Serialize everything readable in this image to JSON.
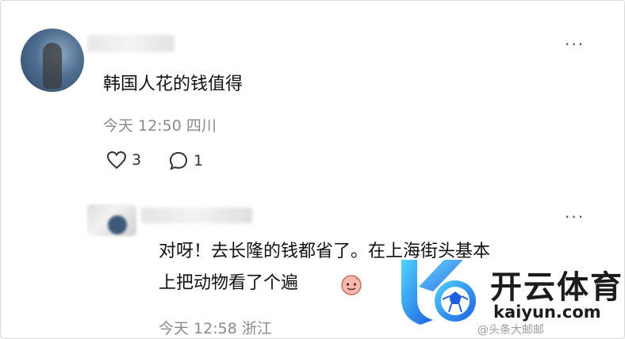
{
  "comment": {
    "text": "韩国人花的钱值得",
    "time_location": "今天 12:50 四川",
    "like_count": "3",
    "reply_count": "1",
    "more_label": "···"
  },
  "reply": {
    "line1": "对呀！去长隆的钱都省了。在上海街头基本",
    "line2": "上把动物看了个遍",
    "time_location": "今天 12:58 浙江",
    "more_label": "···"
  },
  "watermark": {
    "brand": "开云体育",
    "url": "kaiyun.com",
    "credit": "@头条大邮邮"
  }
}
